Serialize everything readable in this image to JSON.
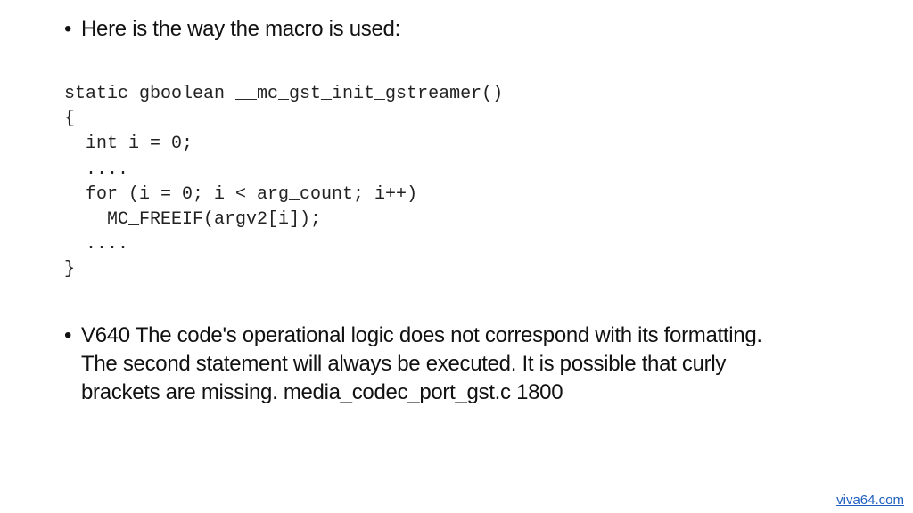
{
  "slide": {
    "bullets": [
      {
        "text": "Here is the way the macro is used:"
      },
      {
        "text": "V640 The code's operational logic does not correspond with its formatting. The second statement will always be executed. It is possible that curly brackets are missing. media_codec_port_gst.c 1800"
      }
    ],
    "bullet_glyph": "•",
    "code_lines": [
      "static gboolean __mc_gst_init_gstreamer()",
      "{",
      "  int i = 0;",
      "  ....",
      "  for (i = 0; i < arg_count; i++)",
      "    MC_FREEIF(argv2[i]);",
      "  ....",
      "}"
    ],
    "footer_link": {
      "label": "viva64.com",
      "color": "#1f5fbf"
    }
  }
}
